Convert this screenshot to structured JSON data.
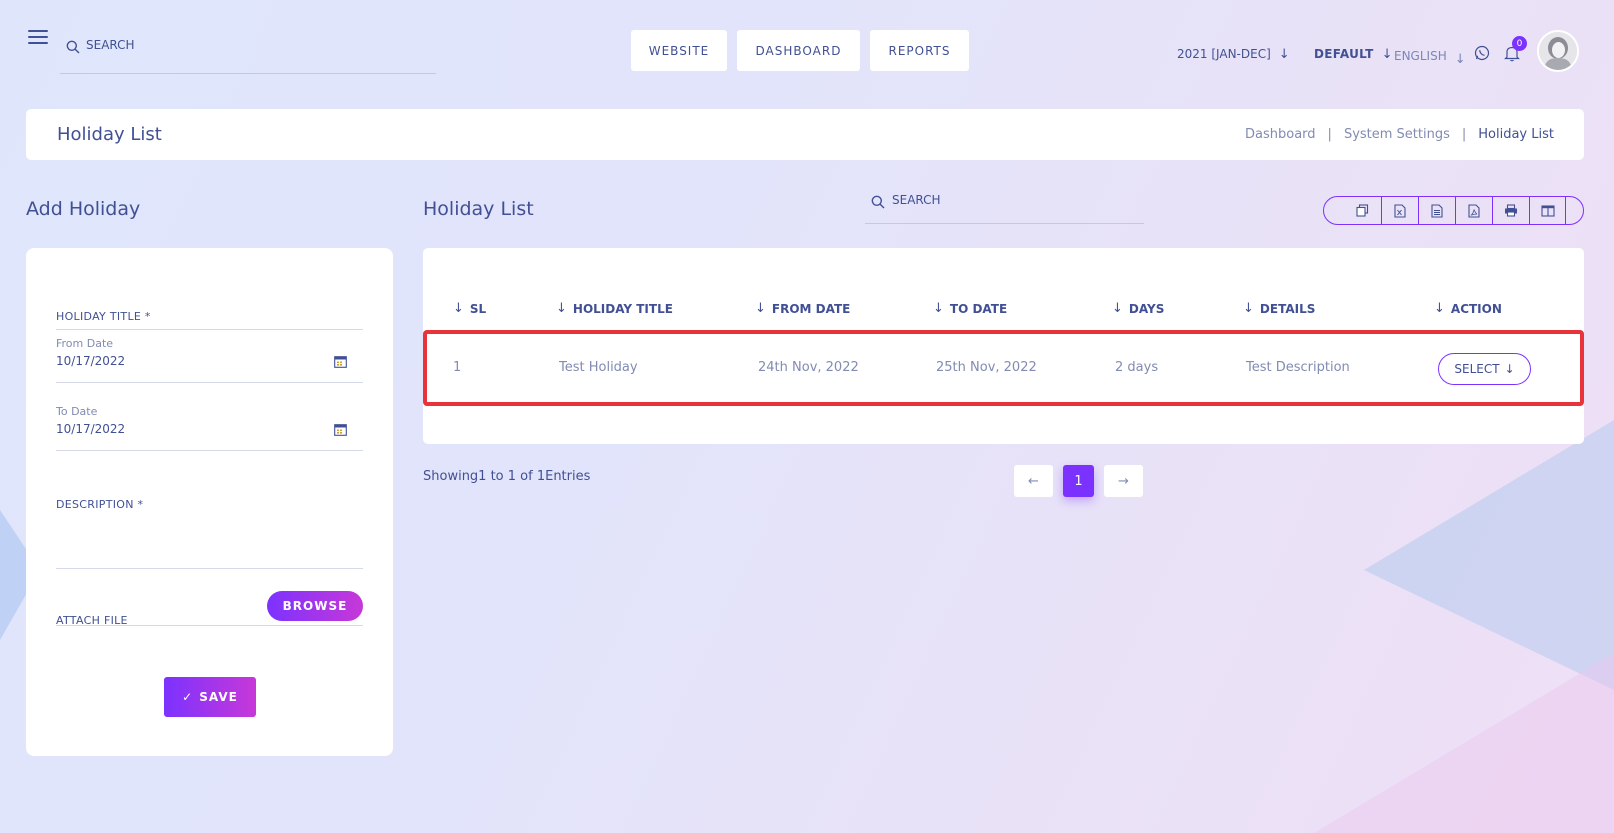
{
  "topbar": {
    "search_placeholder": "SEARCH",
    "nav": [
      {
        "label": "WEBSITE"
      },
      {
        "label": "DASHBOARD"
      },
      {
        "label": "REPORTS"
      }
    ],
    "academic_year": "2021 [JAN-DEC]",
    "style_select": "DEFAULT",
    "language_select": "ENGLISH",
    "notification_count": "0",
    "icons": [
      "menu-icon",
      "search-icon",
      "whatsapp-icon",
      "bell-icon",
      "avatar"
    ]
  },
  "header": {
    "title": "Holiday List",
    "breadcrumb": [
      "Dashboard",
      "System Settings",
      "Holiday List"
    ],
    "separator": "|"
  },
  "add_form": {
    "title": "Add Holiday",
    "holiday_title_label": "HOLIDAY TITLE *",
    "from_date_label": "From Date",
    "from_date_value": "10/17/2022",
    "to_date_label": "To Date",
    "to_date_value": "10/17/2022",
    "description_label": "DESCRIPTION *",
    "attach_label": "ATTACH FILE",
    "browse_label": "BROWSE",
    "save_label": "SAVE",
    "save_check": "✓"
  },
  "list": {
    "title": "Holiday List",
    "search_placeholder": "SEARCH",
    "export_buttons": [
      "copy-icon",
      "excel-icon",
      "csv-icon",
      "pdf-icon",
      "print-icon",
      "columns-icon"
    ],
    "columns": [
      "SL",
      "HOLIDAY TITLE",
      "FROM DATE",
      "TO DATE",
      "DAYS",
      "DETAILS",
      "ACTION"
    ],
    "rows": [
      {
        "sl": "1",
        "title": "Test Holiday",
        "from": "24th Nov, 2022",
        "to": "25th Nov, 2022",
        "days": "2 days",
        "details": "Test Description",
        "action": "SELECT"
      }
    ],
    "showing": "Showing1 to 1 of 1Entries",
    "pagination": {
      "prev": "←",
      "current": "1",
      "next": "→"
    }
  },
  "colors": {
    "primary": "#7c32ff",
    "gradient_end": "#c738d8",
    "text": "#415094",
    "muted": "#828bb2",
    "highlight": "#e8333a"
  }
}
